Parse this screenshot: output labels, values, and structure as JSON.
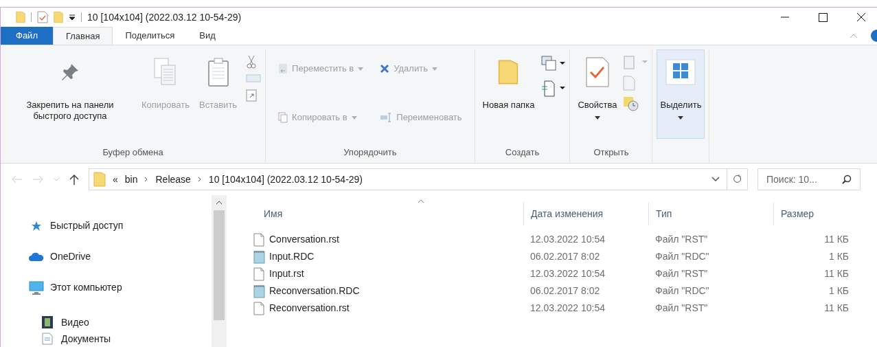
{
  "window": {
    "title": "10 [104x104] (2022.03.12 10-54-29)"
  },
  "tabs": [
    {
      "label": "Файл",
      "kind": "file",
      "selected": false
    },
    {
      "label": "Главная",
      "kind": "tab",
      "selected": true
    },
    {
      "label": "Поделиться",
      "kind": "tab",
      "selected": false
    },
    {
      "label": "Вид",
      "kind": "tab",
      "selected": false
    }
  ],
  "ribbon": [
    {
      "label": "Буфер обмена",
      "items": [
        {
          "kind": "large",
          "label": "Закрепить на панели быстрого доступа",
          "disabled": false,
          "dropdown": false,
          "highlighted": false
        },
        {
          "kind": "large",
          "label": "Копировать",
          "disabled": true,
          "dropdown": false,
          "highlighted": false
        },
        {
          "kind": "large",
          "label": "Вставить",
          "disabled": true,
          "dropdown": false,
          "highlighted": false
        }
      ]
    },
    {
      "label": "Упорядочить",
      "items": [
        {
          "kind": "small",
          "label": "Переместить в",
          "disabled": true,
          "dropdown": true
        },
        {
          "kind": "small",
          "label": "Копировать в",
          "disabled": true,
          "dropdown": true
        },
        {
          "kind": "small",
          "label": "Удалить",
          "disabled": true,
          "dropdown": true
        },
        {
          "kind": "small",
          "label": "Переименовать",
          "disabled": true,
          "dropdown": false
        }
      ]
    },
    {
      "label": "Создать",
      "items": [
        {
          "kind": "large",
          "label": "Новая папка",
          "disabled": false,
          "dropdown": false,
          "highlighted": false
        }
      ]
    },
    {
      "label": "Открыть",
      "items": [
        {
          "kind": "large",
          "label": "Свойства",
          "disabled": false,
          "dropdown": true,
          "highlighted": false
        }
      ]
    },
    {
      "items": [
        {
          "kind": "large",
          "label": "Выделить",
          "disabled": false,
          "dropdown": true,
          "highlighted": true
        }
      ]
    }
  ],
  "address": {
    "crumbs": [
      "«",
      "bin",
      "Release",
      "10 [104x104] (2022.03.12 10-54-29)"
    ]
  },
  "search": {
    "placeholder": "Поиск: 10..."
  },
  "navigation": [
    {
      "label": "Быстрый доступ",
      "kind": "star"
    },
    {
      "label": "OneDrive",
      "kind": "cloud"
    },
    {
      "label": "Этот компьютер",
      "kind": "computer",
      "children": [
        {
          "label": "Видео",
          "kind": "video"
        },
        {
          "label": "Документы",
          "kind": "documents"
        }
      ]
    }
  ],
  "table": {
    "columns": [
      "Имя",
      "Дата изменения",
      "Тип",
      "Размер"
    ],
    "rows": [
      {
        "kind": "document",
        "name": "Conversation.rst",
        "date": "12.03.2022 10:54",
        "type": "Файл \"RST\"",
        "size": "11 КБ"
      },
      {
        "kind": "notepad",
        "name": "Input.RDC",
        "date": "06.02.2017 8:02",
        "type": "Файл \"RDC\"",
        "size": "1 КБ"
      },
      {
        "kind": "document",
        "name": "Input.rst",
        "date": "12.03.2022 10:54",
        "type": "Файл \"RST\"",
        "size": "11 КБ"
      },
      {
        "kind": "notepad",
        "name": "Reconversation.RDC",
        "date": "06.02.2017 8:02",
        "type": "Файл \"RDC\"",
        "size": "1 КБ"
      },
      {
        "kind": "document",
        "name": "Reconversation.rst",
        "date": "12.03.2022 10:54",
        "type": "Файл \"RST\"",
        "size": "11 КБ"
      }
    ]
  }
}
